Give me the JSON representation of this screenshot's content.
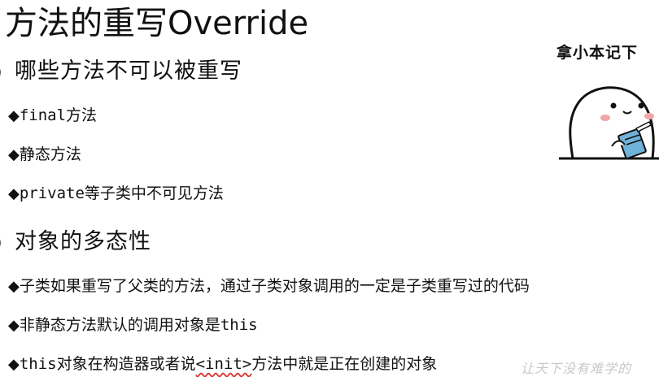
{
  "title": "方法的重写Override",
  "sections": [
    {
      "heading": "哪些方法不可以被重写",
      "items": [
        "final方法",
        "静态方法",
        "private等子类中不可见方法"
      ]
    },
    {
      "heading": "对象的多态性",
      "items": [
        "子类如果重写了父类的方法，通过子类对象调用的一定是子类重写过的代码",
        "非静态方法默认的调用对象是this"
      ],
      "last_item": {
        "before": "this对象在构造器或者说",
        "underlined": "<init>",
        "after": "方法中就是正在创建的对象"
      }
    }
  ],
  "sticker": {
    "text": "拿小本记下",
    "icon": "note-taking-character-icon"
  },
  "watermark": "让天下没有难学的",
  "bullet_symbol": "◆",
  "section_symbol": ")"
}
